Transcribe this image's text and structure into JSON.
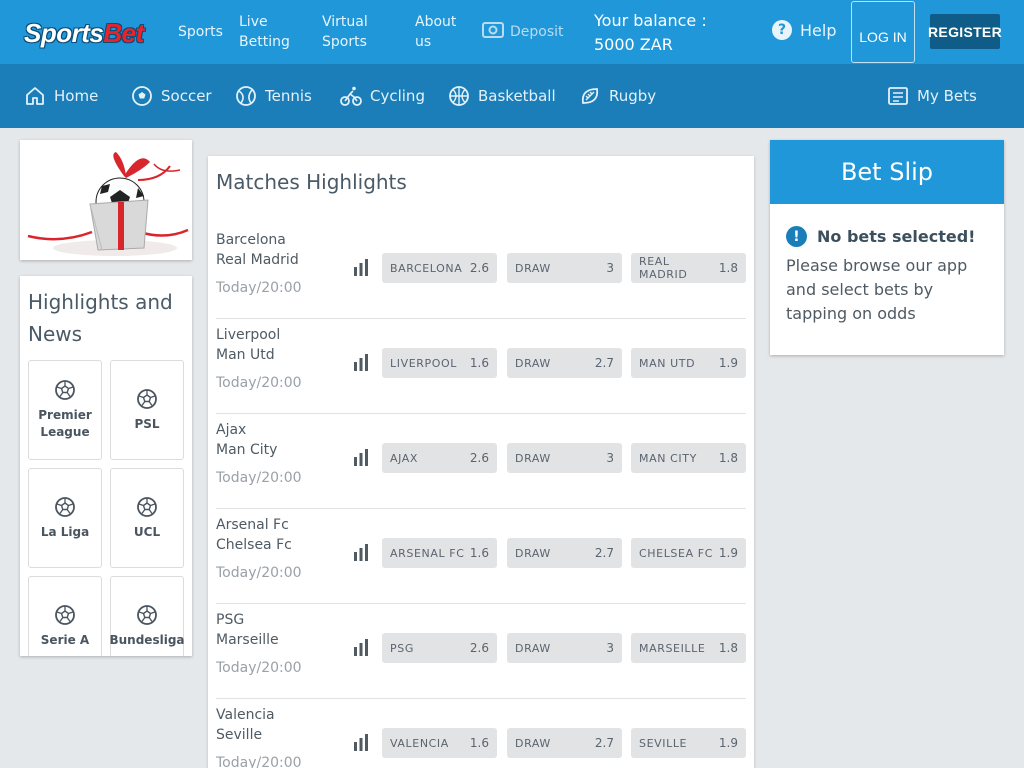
{
  "header": {
    "logo_white": "Sports",
    "logo_red": "Bet",
    "links": [
      "Sports",
      "Live Betting",
      "Virtual Sports",
      "About us"
    ],
    "deposit": "Deposit",
    "balance_label": "Your balance :",
    "balance_value": "5000 ZAR",
    "help": "Help",
    "login": "LOG IN",
    "register": "REGISTER"
  },
  "nav": {
    "items": [
      {
        "label": "Home",
        "icon": "home-icon"
      },
      {
        "label": "Soccer",
        "icon": "soccer-ball-icon"
      },
      {
        "label": "Tennis",
        "icon": "tennis-ball-icon"
      },
      {
        "label": "Cycling",
        "icon": "cycling-icon"
      },
      {
        "label": "Basketball",
        "icon": "basketball-icon"
      },
      {
        "label": "Rugby",
        "icon": "rugby-ball-icon"
      }
    ],
    "my_bets": "My Bets"
  },
  "sidebar": {
    "news_title": "Highlights and News",
    "leagues": [
      "Premier League",
      "PSL",
      "La Liga",
      "UCL",
      "Serie A",
      "Bundesliga"
    ]
  },
  "matches": {
    "title": "Matches Highlights",
    "list": [
      {
        "home": "Barcelona",
        "away": "Real Madrid",
        "time": "Today/20:00",
        "odds": [
          {
            "label": "BARCELONA",
            "value": "2.6"
          },
          {
            "label": "DRAW",
            "value": "3"
          },
          {
            "label": "REAL MADRID",
            "value": "1.8"
          }
        ]
      },
      {
        "home": "Liverpool",
        "away": "Man Utd",
        "time": "Today/20:00",
        "odds": [
          {
            "label": "LIVERPOOL",
            "value": "1.6"
          },
          {
            "label": "DRAW",
            "value": "2.7"
          },
          {
            "label": "MAN UTD",
            "value": "1.9"
          }
        ]
      },
      {
        "home": "Ajax",
        "away": "Man City",
        "time": "Today/20:00",
        "odds": [
          {
            "label": "AJAX",
            "value": "2.6"
          },
          {
            "label": "DRAW",
            "value": "3"
          },
          {
            "label": "MAN CITY",
            "value": "1.8"
          }
        ]
      },
      {
        "home": "Arsenal Fc",
        "away": "Chelsea Fc",
        "time": "Today/20:00",
        "odds": [
          {
            "label": "ARSENAL FC",
            "value": "1.6"
          },
          {
            "label": "DRAW",
            "value": "2.7"
          },
          {
            "label": "CHELSEA FC",
            "value": "1.9"
          }
        ]
      },
      {
        "home": "PSG",
        "away": "Marseille",
        "time": "Today/20:00",
        "odds": [
          {
            "label": "PSG",
            "value": "2.6"
          },
          {
            "label": "DRAW",
            "value": "3"
          },
          {
            "label": "MARSEILLE",
            "value": "1.8"
          }
        ]
      },
      {
        "home": "Valencia",
        "away": "Seville",
        "time": "Today/20:00",
        "odds": [
          {
            "label": "VALENCIA",
            "value": "1.6"
          },
          {
            "label": "DRAW",
            "value": "2.7"
          },
          {
            "label": "SEVILLE",
            "value": "1.9"
          }
        ]
      }
    ]
  },
  "betslip": {
    "title": "Bet Slip",
    "empty_title": "No bets selected!",
    "empty_text": "Please browse our app and select bets by tapping on odds"
  },
  "colors": {
    "header_blue": "#1f97d9",
    "nav_blue": "#1b7eb8",
    "register_navy": "#0e5c87",
    "logo_red": "#e8242b"
  }
}
